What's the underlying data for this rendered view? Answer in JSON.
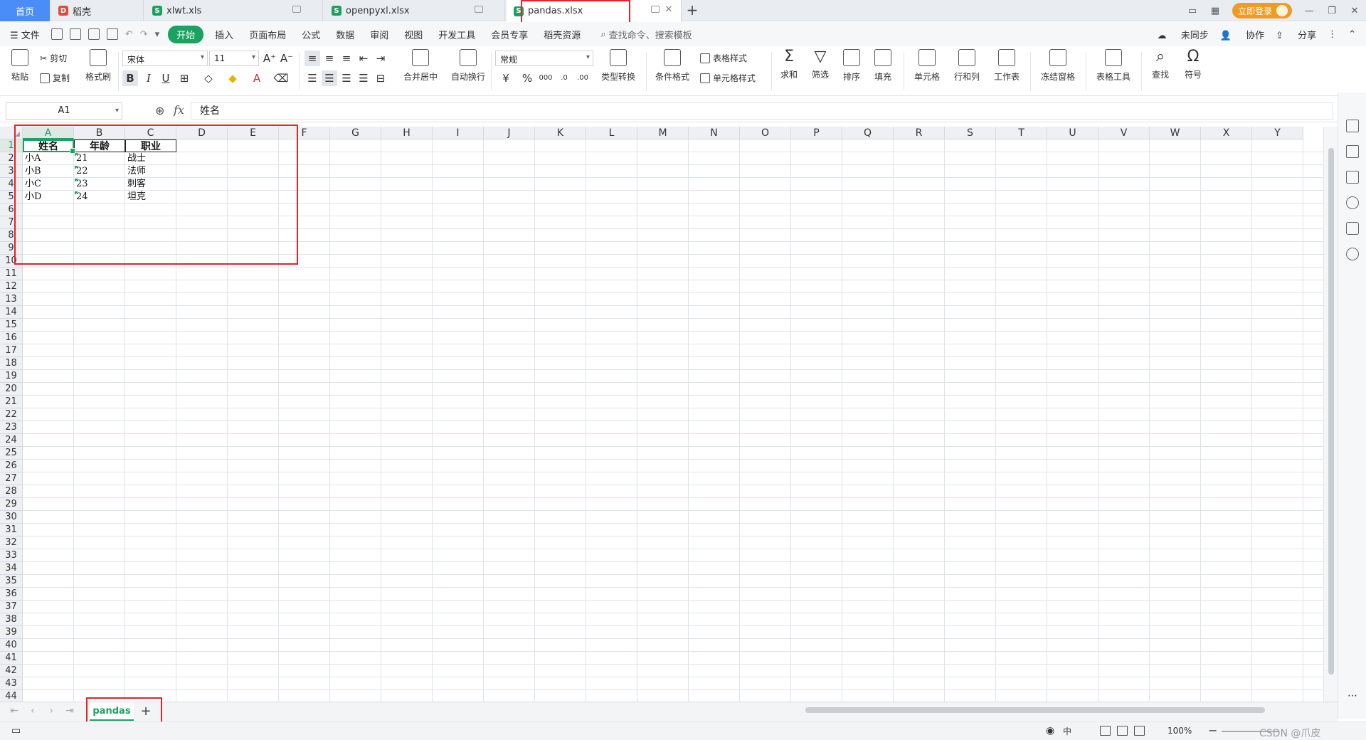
{
  "tabs": {
    "home": "首页",
    "daoke": "稻壳",
    "xlwt": "xlwt.xls",
    "openpyxl": "openpyxl.xlsx",
    "pandas": "pandas.xlsx"
  },
  "window": {
    "login_label": "立即登录"
  },
  "menu": {
    "file": "文件",
    "start": "开始",
    "items": [
      "插入",
      "页面布局",
      "公式",
      "数据",
      "审阅",
      "视图",
      "开发工具",
      "会员专享",
      "稻壳资源"
    ],
    "search_placeholder": "查找命令、搜索模板",
    "right": [
      "未同步",
      "协作",
      "分享"
    ]
  },
  "ribbon": {
    "paste": "粘贴",
    "cut": "剪切",
    "copy": "复制",
    "format_painter": "格式刷",
    "font_name": "宋体",
    "font_size": "11",
    "merge_center": "合并居中",
    "wrap_text": "自动换行",
    "number_format": "常规",
    "type_convert": "类型转换",
    "cond_format": "条件格式",
    "table_style": "表格样式",
    "cell_style": "单元格样式",
    "sum": "求和",
    "filter": "筛选",
    "sort": "排序",
    "fill": "填充",
    "cell": "单元格",
    "row_col": "行和列",
    "worksheet": "工作表",
    "freeze": "冻结窗格",
    "table_tools": "表格工具",
    "find": "查找",
    "symbol": "符号"
  },
  "formula_bar": {
    "name_box": "A1",
    "fx": "fx",
    "content": "姓名"
  },
  "grid": {
    "columns": [
      "A",
      "B",
      "C",
      "D",
      "E",
      "F",
      "G",
      "H",
      "I",
      "J",
      "K",
      "L",
      "M",
      "N",
      "O",
      "P",
      "Q",
      "R",
      "S",
      "T",
      "U",
      "V",
      "W",
      "X",
      "Y"
    ],
    "row_count": 44,
    "headers": [
      "姓名",
      "年龄",
      "职业"
    ],
    "rows": [
      [
        "小A",
        "21",
        "战士"
      ],
      [
        "小B",
        "22",
        "法师"
      ],
      [
        "小C",
        "23",
        "刺客"
      ],
      [
        "小D",
        "24",
        "坦克"
      ]
    ]
  },
  "sheet": {
    "name": "pandas"
  },
  "status": {
    "zoom": "100%",
    "watermark": "CSDN @爪皮"
  },
  "colors": {
    "accent": "#1aa260",
    "highlight": "#e8212a",
    "home_tab": "#4b8df8",
    "login": "#f29b24"
  }
}
